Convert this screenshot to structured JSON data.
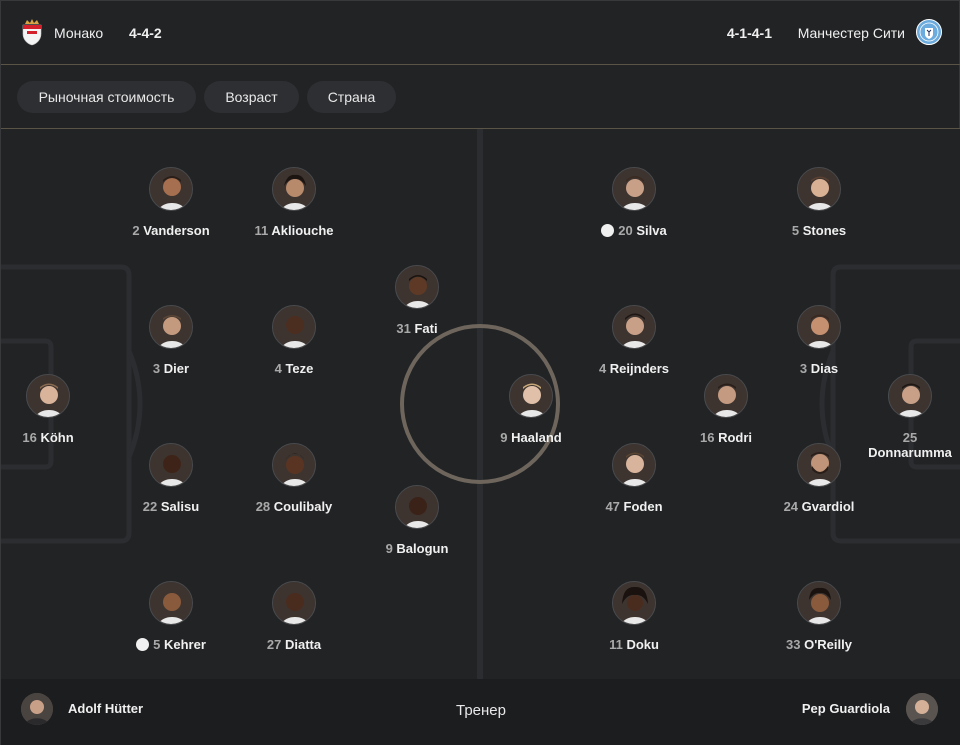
{
  "header": {
    "home": {
      "name": "Монако",
      "formation": "4-4-2"
    },
    "away": {
      "name": "Манчестер Сити",
      "formation": "4-1-4-1"
    }
  },
  "filters": [
    "Рыночная стоимость",
    "Возраст",
    "Страна"
  ],
  "home_players": [
    {
      "num": "2",
      "name": "Vanderson",
      "icon": "player-photo",
      "card": false
    },
    {
      "num": "11",
      "name": "Akliouche",
      "icon": "player-photo",
      "card": false
    },
    {
      "num": "31",
      "name": "Fati",
      "icon": "player-photo",
      "card": false
    },
    {
      "num": "3",
      "name": "Dier",
      "icon": "player-photo",
      "card": false
    },
    {
      "num": "4",
      "name": "Teze",
      "icon": "player-photo",
      "card": false
    },
    {
      "num": "16",
      "name": "Köhn",
      "icon": "player-photo",
      "card": false
    },
    {
      "num": "22",
      "name": "Salisu",
      "icon": "player-photo",
      "card": false
    },
    {
      "num": "28",
      "name": "Coulibaly",
      "icon": "player-photo",
      "card": false
    },
    {
      "num": "9",
      "name": "Balogun",
      "icon": "player-photo",
      "card": false
    },
    {
      "num": "5",
      "name": "Kehrer",
      "icon": "player-photo",
      "card": true
    },
    {
      "num": "27",
      "name": "Diatta",
      "icon": "player-photo",
      "card": false
    }
  ],
  "away_players": [
    {
      "num": "20",
      "name": "Silva",
      "icon": "player-photo",
      "card": true
    },
    {
      "num": "5",
      "name": "Stones",
      "icon": "player-photo",
      "card": false
    },
    {
      "num": "4",
      "name": "Reijnders",
      "icon": "player-photo",
      "card": false
    },
    {
      "num": "3",
      "name": "Dias",
      "icon": "player-photo",
      "card": false
    },
    {
      "num": "9",
      "name": "Haaland",
      "icon": "player-photo",
      "card": false
    },
    {
      "num": "16",
      "name": "Rodri",
      "icon": "player-photo",
      "card": false
    },
    {
      "num": "25",
      "name": "Donnarumma",
      "icon": "player-photo",
      "card": false
    },
    {
      "num": "47",
      "name": "Foden",
      "icon": "player-photo",
      "card": false
    },
    {
      "num": "24",
      "name": "Gvardiol",
      "icon": "player-photo",
      "card": false
    },
    {
      "num": "11",
      "name": "Doku",
      "icon": "player-photo",
      "card": false
    },
    {
      "num": "33",
      "name": "O'Reilly",
      "icon": "player-photo",
      "card": false
    }
  ],
  "coaches": {
    "label": "Тренер",
    "home": "Adolf Hütter",
    "away": "Pep Guardiola"
  },
  "colors": {
    "background": "#222325",
    "chip": "#2e2f32",
    "pitch_lines": "#2c2d30",
    "center_circle": "#6e665c",
    "monaco_red": "#d4202a",
    "city_blue": "#6cabdd"
  }
}
